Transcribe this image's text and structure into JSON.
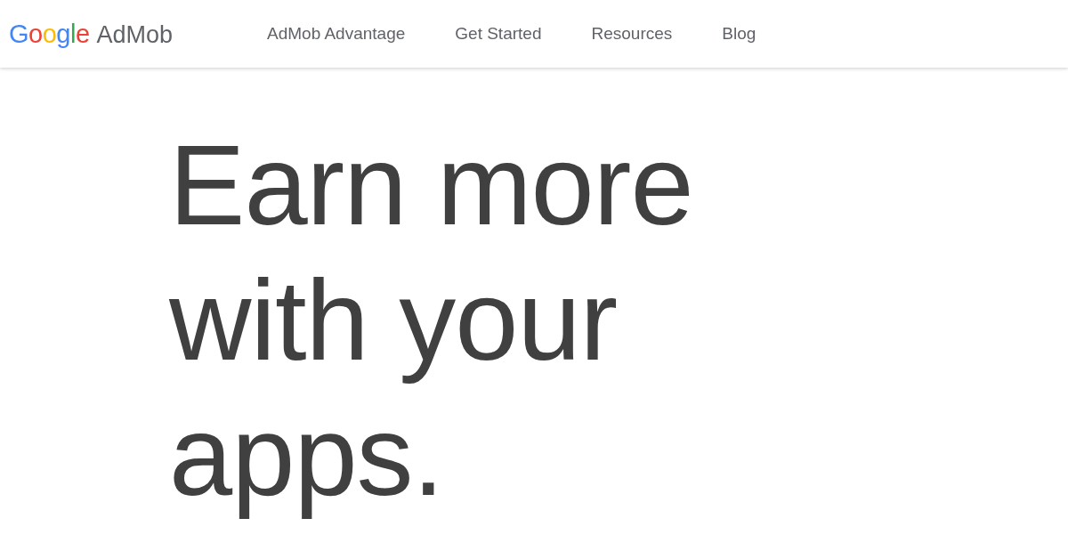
{
  "header": {
    "logo": {
      "brand": "Google",
      "product": "AdMob"
    },
    "nav": [
      {
        "label": "AdMob Advantage"
      },
      {
        "label": "Get Started"
      },
      {
        "label": "Resources"
      },
      {
        "label": "Blog"
      }
    ]
  },
  "hero": {
    "lines": [
      "Earn more",
      "with your",
      "apps."
    ]
  }
}
